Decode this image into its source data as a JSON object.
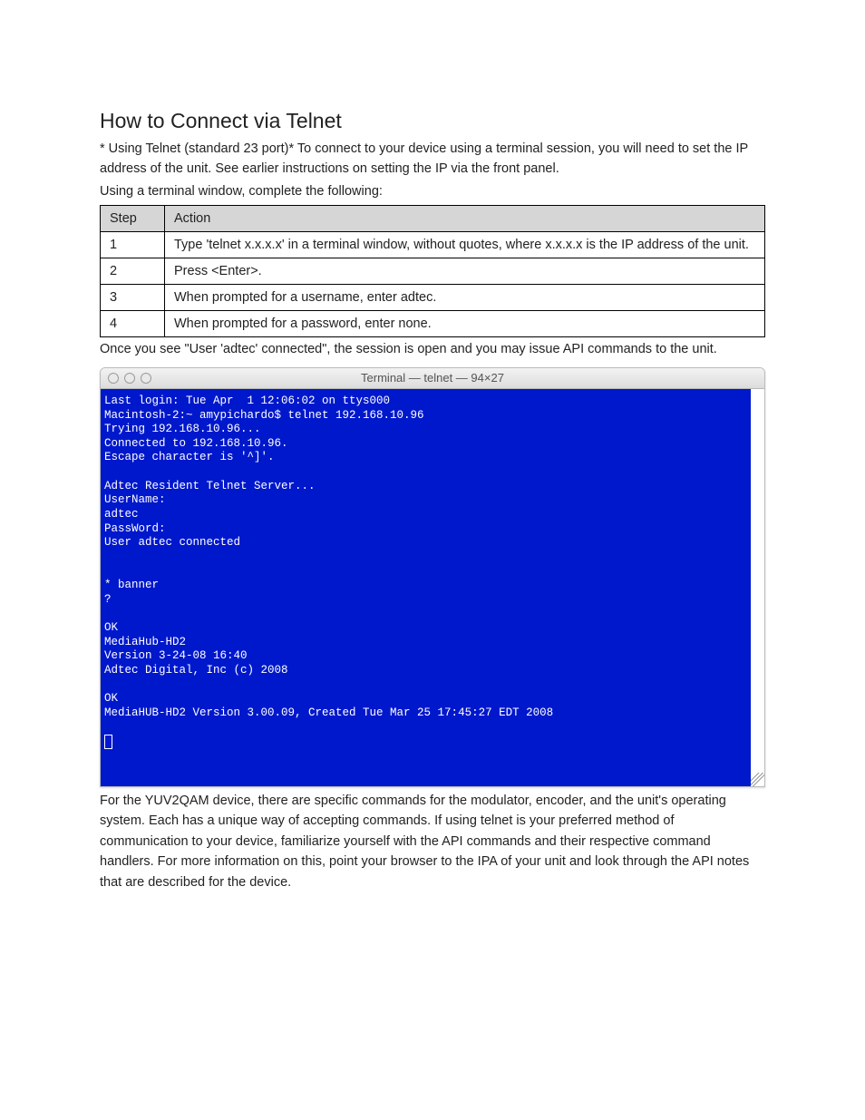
{
  "title": "How to Connect  via Telnet",
  "intro": "* Using Telnet (standard 23 port)* To connect to your device using a terminal session, you will need to set the IP address of the unit. See earlier instructions on setting the IP via the front panel.",
  "intro2": "Using a terminal window, complete the following:",
  "table": {
    "headers": {
      "step": "Step",
      "action": "Action"
    },
    "rows": [
      {
        "step": "1",
        "action": "Type 'telnet x.x.x.x' in a terminal window, without quotes, where x.x.x.x is the IP address of the unit."
      },
      {
        "step": "2",
        "action": "Press <Enter>."
      },
      {
        "step": "3",
        "action": "When prompted for a username, enter adtec."
      },
      {
        "step": "4",
        "action": "When prompted for a password, enter none."
      }
    ]
  },
  "after_table": "Once you see \"User 'adtec' connected\", the session is open and you may issue API commands to the unit.",
  "terminal": {
    "title": "Terminal — telnet — 94×27",
    "content": "Last login: Tue Apr  1 12:06:02 on ttys000\nMacintosh-2:~ amypichardo$ telnet 192.168.10.96\nTrying 192.168.10.96...\nConnected to 192.168.10.96.\nEscape character is '^]'.\n\nAdtec Resident Telnet Server...\nUserName:\nadtec\nPassWord:\nUser adtec connected\n\n\n* banner\n?\n\nOK\nMediaHub-HD2\nVersion 3-24-08 16:40\nAdtec Digital, Inc (c) 2008\n\nOK\nMediaHUB-HD2 Version 3.00.09, Created Tue Mar 25 17:45:27 EDT 2008\n"
  },
  "closing": "For the YUV2QAM device, there are specific commands for the modulator, encoder, and the unit's operating system. Each has a unique way of accepting commands. If using telnet is your preferred method of communication to your device, familiarize yourself with the API commands and their respective command handlers. For more information on this, point your browser to the IPA of your unit and look through the API notes that are described for the device."
}
